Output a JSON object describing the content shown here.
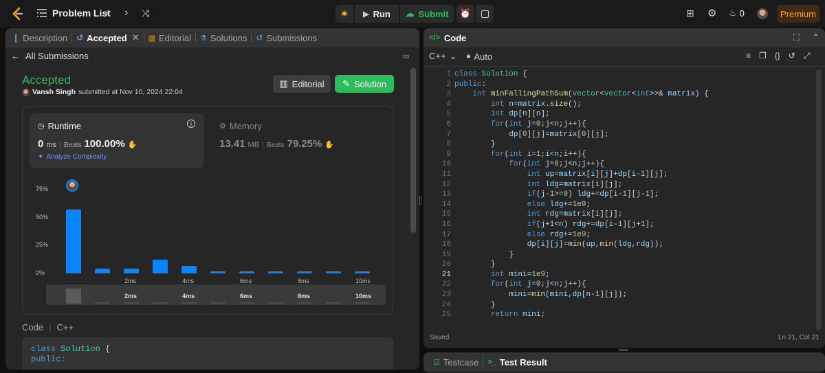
{
  "topbar": {
    "problem_list": "Problem List",
    "run": "Run",
    "submit": "Submit",
    "streak": "0",
    "premium": "Premium"
  },
  "left": {
    "tabs": [
      "Description",
      "Accepted",
      "Editorial",
      "Solutions",
      "Submissions"
    ],
    "all_submissions": "All Submissions",
    "status": "Accepted",
    "user": "Vansh Singh",
    "submitted_text": "submitted at Nov 10, 2024 22:04",
    "editorial_btn": "Editorial",
    "solution_btn": "Solution",
    "runtime": {
      "label": "Runtime",
      "value": "0",
      "unit": "ms",
      "beats_label": "Beats",
      "beats": "100.00%"
    },
    "memory": {
      "label": "Memory",
      "value": "13.41",
      "unit": "MB",
      "beats_label": "Beats",
      "beats": "79.25%"
    },
    "analyze": "Analyze Complexity",
    "code_label": "Code",
    "code_lang": "C++",
    "code_preview": [
      "class Solution {",
      "public:"
    ]
  },
  "chart_data": {
    "type": "bar",
    "categories": [
      "0ms",
      "1ms",
      "2ms",
      "3ms",
      "4ms",
      "5ms",
      "6ms",
      "7ms",
      "8ms",
      "9ms",
      "10ms"
    ],
    "values": [
      57,
      4,
      4,
      12,
      7,
      2,
      2,
      2,
      2,
      2,
      2
    ],
    "y_ticks": [
      "75%",
      "50%",
      "25%",
      "0%"
    ],
    "x_ticks": [
      "2ms",
      "4ms",
      "6ms",
      "8ms",
      "10ms"
    ],
    "ylim": [
      0,
      75
    ],
    "color": "#0a84ff",
    "mini_values": [
      22,
      2,
      2,
      2,
      2,
      2,
      2,
      2,
      2,
      2,
      2
    ]
  },
  "editor": {
    "title": "Code",
    "lang": "C++",
    "mode": "Auto",
    "status": "Saved",
    "cursor": "Ln 21, Col 21",
    "active_line": 21,
    "lines": [
      "class Solution {",
      "public:",
      "    int minFallingPathSum(vector<vector<int>>& matrix) {",
      "        int n=matrix.size();",
      "        int dp[n][n];",
      "        for(int j=0;j<n;j++){",
      "            dp[0][j]=matrix[0][j];",
      "        }",
      "        for(int i=1;i<n;i++){",
      "            for(int j=0;j<n;j++){",
      "                int up=matrix[i][j]+dp[i-1][j];",
      "                int ldg=matrix[i][j];",
      "                if(j-1>=0) ldg+=dp[i-1][j-1];",
      "                else ldg+=1e9;",
      "                int rdg=matrix[i][j];",
      "                if(j+1<n) rdg+=dp[i-1][j+1];",
      "                else rdg+=1e9;",
      "                dp[i][j]=min(up,min(ldg,rdg));",
      "            }",
      "        }",
      "        int mini=1e9;",
      "        for(int j=0;j<n;j++){",
      "            mini=min(mini,dp[n-1][j]);",
      "        }",
      "        return mini;"
    ]
  },
  "bottom": {
    "testcase": "Testcase",
    "test_result": "Test Result"
  }
}
